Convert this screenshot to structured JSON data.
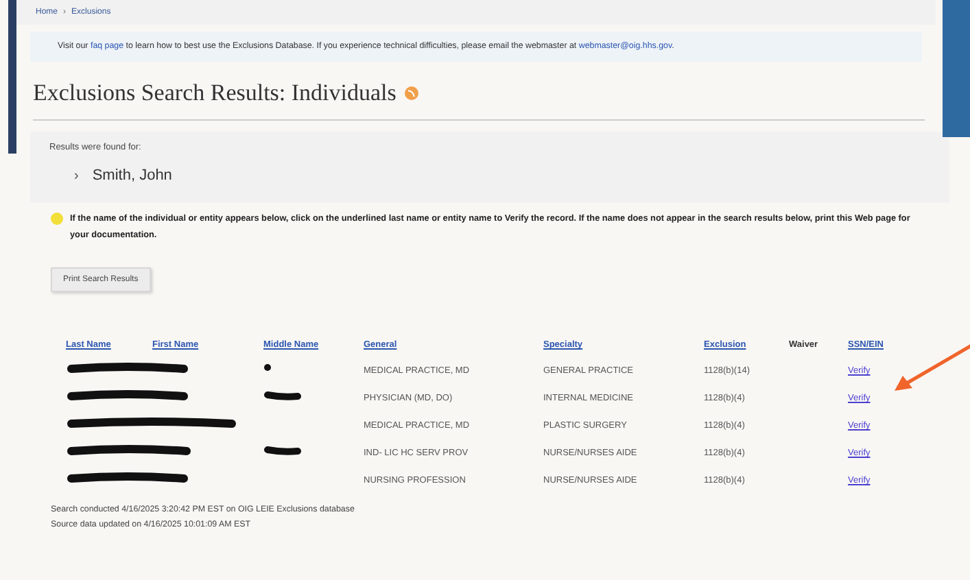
{
  "breadcrumb": [
    {
      "text": "Home"
    },
    {
      "text": "Exclusions"
    }
  ],
  "breadcrumb_separator": "›",
  "result_bullet": "›",
  "notice": [
    {
      "text": "Visit our ",
      "link": false
    },
    {
      "text": "faq page",
      "link": true
    },
    {
      "text": " to learn how to best use the Exclusions Database. If you experience technical difficulties, please email the webmaster at ",
      "link": false
    },
    {
      "text": "webmaster@oig.hhs.gov",
      "link": true
    },
    {
      "text": ".",
      "link": false
    }
  ],
  "title": "Exclusions Search Results: Individuals",
  "results_label": "Results were found for:",
  "results": [
    "Smith, John"
  ],
  "warning": "If the name of the individual or entity appears below, click on the underlined last name or entity name to Verify the record. If the name does not appear in the search results below, print this Web page for your documentation.",
  "print_button": "Print Search Results",
  "table": {
    "columns": [
      {
        "label": "Last Name",
        "link": true
      },
      {
        "label": "First Name",
        "link": true
      },
      {
        "label": "Middle Name",
        "link": true
      },
      {
        "label": "General",
        "link": true
      },
      {
        "label": "Specialty",
        "link": true
      },
      {
        "label": "Exclusion",
        "link": true
      },
      {
        "label": "Waiver",
        "link": false
      },
      {
        "label": "SSN/EIN",
        "link": true
      }
    ],
    "rows": [
      {
        "name_redacted": true,
        "middle_name": {
          "kind": "dot"
        },
        "general": "MEDICAL PRACTICE, MD",
        "specialty": "GENERAL PRACTICE",
        "exclusion": "1128(b)(14)",
        "action": "Verify"
      },
      {
        "name_redacted": true,
        "middle_name": {
          "kind": "stroke"
        },
        "general": "PHYSICIAN (MD, DO)",
        "specialty": "INTERNAL MEDICINE",
        "exclusion": "1128(b)(4)",
        "action": "Verify"
      },
      {
        "name_redacted": true,
        "middle_name": {
          "kind": "none"
        },
        "general": "MEDICAL PRACTICE, MD",
        "specialty": "PLASTIC SURGERY",
        "exclusion": "1128(b)(4)",
        "action": "Verify"
      },
      {
        "name_redacted": true,
        "middle_name": {
          "kind": "stroke"
        },
        "general": "IND- LIC HC SERV PROV",
        "specialty": "NURSE/NURSES AIDE",
        "exclusion": "1128(b)(4)",
        "action": "Verify"
      },
      {
        "name_redacted": true,
        "middle_name": {
          "kind": "none"
        },
        "general": "NURSING PROFESSION",
        "specialty": "NURSE/NURSES AIDE",
        "exclusion": "1128(b)(4)",
        "action": "Verify"
      }
    ]
  },
  "footer": [
    "Search conducted 4/16/2025 3:20:42 PM EST on OIG LEIE Exclusions database",
    "Source data updated on 4/16/2025 10:01:09 AM EST"
  ],
  "annotation": {
    "kind": "arrow"
  }
}
